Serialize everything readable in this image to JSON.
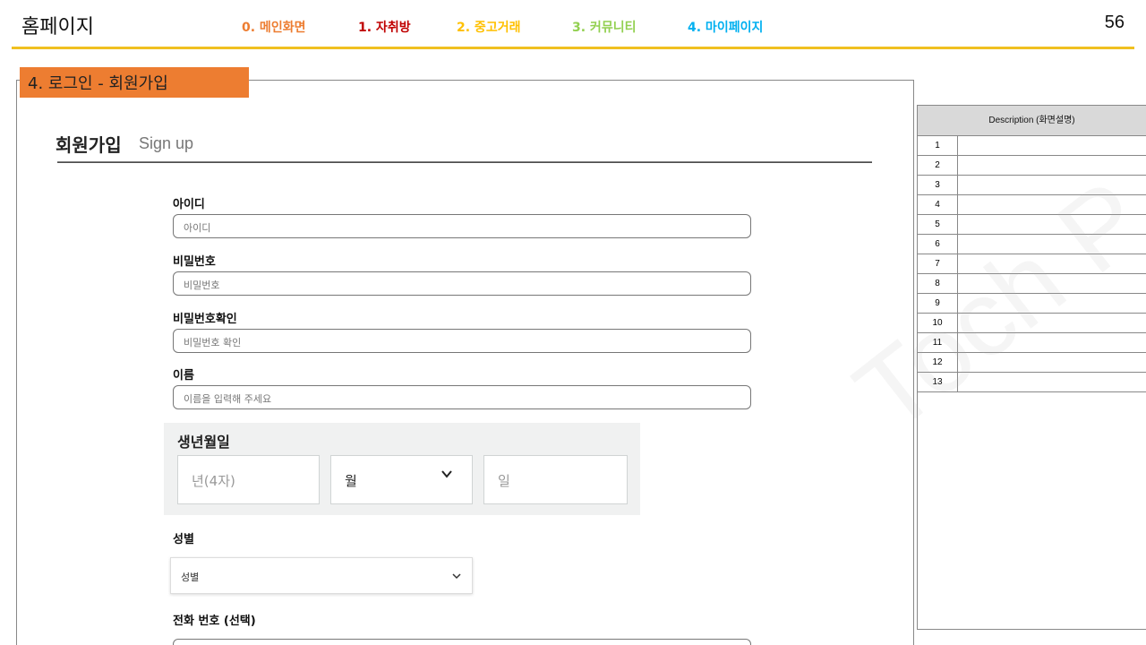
{
  "header": {
    "title": "홈페이지",
    "page_number": "56",
    "nav": [
      "0. 메인화면",
      "1. 자취방",
      "2. 중고거래",
      "3. 커뮤니티",
      "4. 마이페이지"
    ]
  },
  "section_badge": "4. 로그인 - 회원가입",
  "signup": {
    "title": "회원가입",
    "subtitle": "Sign up",
    "fields": [
      {
        "label": "아이디",
        "placeholder": "아이디"
      },
      {
        "label": "비밀번호",
        "placeholder": "비밀번호"
      },
      {
        "label": "비밀번호확인",
        "placeholder": "비밀번호 확인"
      },
      {
        "label": "이름",
        "placeholder": "이름을 입력해 주세요"
      }
    ],
    "birth": {
      "label": "생년월일",
      "year_placeholder": "년(4자)",
      "month_value": "월",
      "day_placeholder": "일"
    },
    "gender": {
      "label": "성별",
      "value": "성별"
    },
    "phone": {
      "label": "전화 번호 (선택)"
    }
  },
  "description": {
    "header": "Description (화면설명)",
    "rows": [
      "1",
      "2",
      "3",
      "4",
      "5",
      "6",
      "7",
      "8",
      "9",
      "10",
      "11",
      "12",
      "13"
    ]
  },
  "watermark": "Toch P"
}
